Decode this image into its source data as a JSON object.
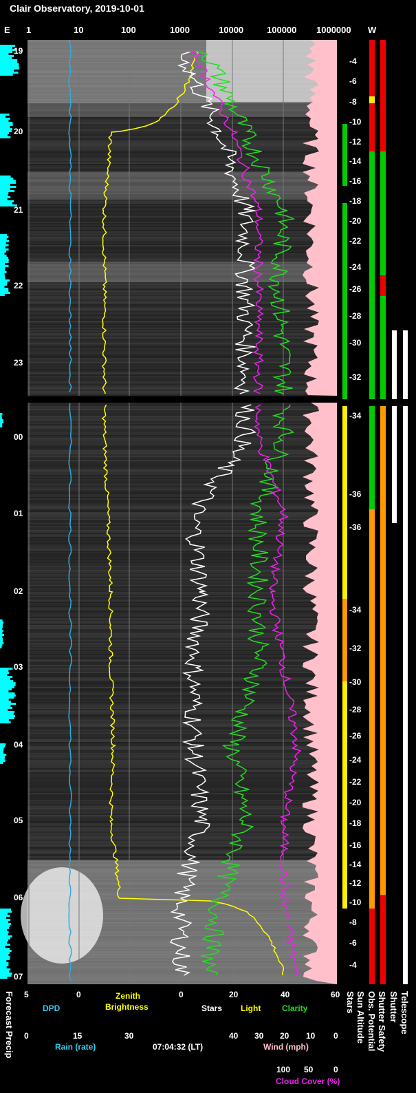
{
  "title": "Clair Observatory, 2019-10-01",
  "top_axis": {
    "left_letter": "E",
    "right_letter": "W",
    "ticks": [
      "1",
      "10",
      "100",
      "1000",
      "10000",
      "100000",
      "1000000"
    ]
  },
  "hours": [
    "19",
    "20",
    "21",
    "22",
    "23",
    "00",
    "01",
    "02",
    "03",
    "04",
    "05",
    "06",
    "07"
  ],
  "sun_altitude_ticks_upper": [
    "-4",
    "-6",
    "-8",
    "-10",
    "-12",
    "-14",
    "-16",
    "-18",
    "-20",
    "-22",
    "-24",
    "-26",
    "-28",
    "-30",
    "-32"
  ],
  "sun_altitude_ticks_lower": [
    "-34",
    "-36",
    "-36",
    "-34",
    "-32",
    "-30",
    "-28",
    "-26",
    "-24",
    "-22",
    "-20",
    "-18",
    "-16",
    "-14",
    "-12",
    "-10",
    "-8",
    "-6",
    "-4"
  ],
  "bottom": {
    "row1_ticks": [
      "5",
      "0",
      "0",
      "20",
      "40",
      "60"
    ],
    "dpd": "DPD",
    "zenith": "Zenith",
    "brightness": "Brightness",
    "stars": "Stars",
    "light": "Light",
    "clarity": "Clarity",
    "row2_ticks": [
      "0",
      "15",
      "30"
    ],
    "rain": "Rain (rate)",
    "time": "07:04:32 (LT)",
    "wind_ticks": [
      "40",
      "30",
      "20",
      "10",
      "0"
    ],
    "wind": "Wind (mph)",
    "cloud_ticks": [
      "100",
      "50",
      "0"
    ],
    "cloud": "Cloud Cover (%)"
  },
  "vertical_labels": {
    "forecast": "Forecast Precip",
    "stars": "Stars",
    "sun": "Sun Altitude",
    "obs": "Obs. Potential",
    "shutter_safety": "Shutter Safety",
    "shutter": "Shutter",
    "telescope": "Telescope"
  },
  "colors": {
    "zenith": "#ffff00",
    "stars": "#ffffff",
    "clarity": "#22dd22",
    "cloud": "#ee22ee",
    "dpd": "#33aadd",
    "precip": "#00ffff",
    "wind_fill": "#ffc0cb",
    "safe": "#00cc00",
    "unsafe": "#ee0000",
    "marginal": "#ff9900"
  },
  "chart_data": {
    "type": "line",
    "title": "Clair Observatory, 2019-10-01",
    "x_axis": "time (LT)",
    "x": [
      "19",
      "20",
      "21",
      "22",
      "23",
      "00",
      "01",
      "02",
      "03",
      "04",
      "05",
      "06",
      "07"
    ],
    "series": [
      {
        "name": "Zenith Brightness",
        "values": [
          2000,
          40,
          30,
          30,
          30,
          30,
          35,
          40,
          40,
          45,
          40,
          60,
          100000
        ]
      },
      {
        "name": "Stars",
        "values": [
          0,
          15,
          25,
          25,
          25,
          25,
          5,
          8,
          5,
          5,
          8,
          0,
          0
        ]
      },
      {
        "name": "Clarity",
        "values": [
          10,
          25,
          40,
          38,
          40,
          40,
          30,
          30,
          30,
          20,
          25,
          15,
          10
        ]
      },
      {
        "name": "Cloud Cover",
        "values": [
          5,
          20,
          30,
          30,
          30,
          30,
          40,
          35,
          40,
          45,
          40,
          40,
          45
        ]
      }
    ],
    "top_scale": "log 1 to 1000000",
    "bottom_scale_linear": [
      0,
      60
    ]
  }
}
